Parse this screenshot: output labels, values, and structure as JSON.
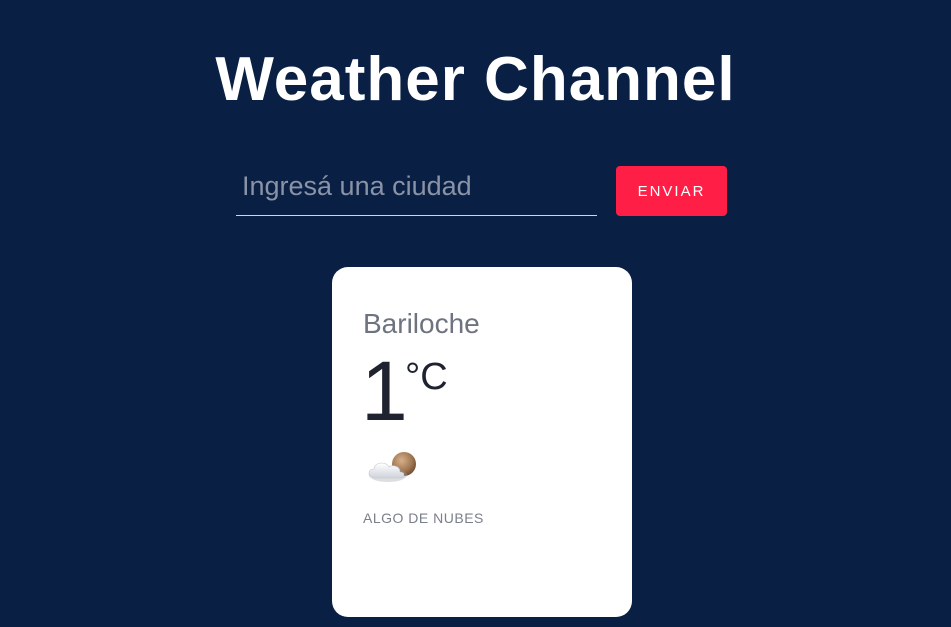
{
  "header": {
    "title": "Weather Channel"
  },
  "search": {
    "placeholder": "Ingresá una ciudad",
    "value": "",
    "button_label": "ENVIAR"
  },
  "weather": {
    "city": "Bariloche",
    "temperature": "1",
    "unit": "°C",
    "icon": "cloud-moon-icon",
    "description": "ALGO DE NUBES"
  },
  "colors": {
    "background": "#0a1f44",
    "accent": "#ff1e46",
    "card": "#ffffff"
  }
}
